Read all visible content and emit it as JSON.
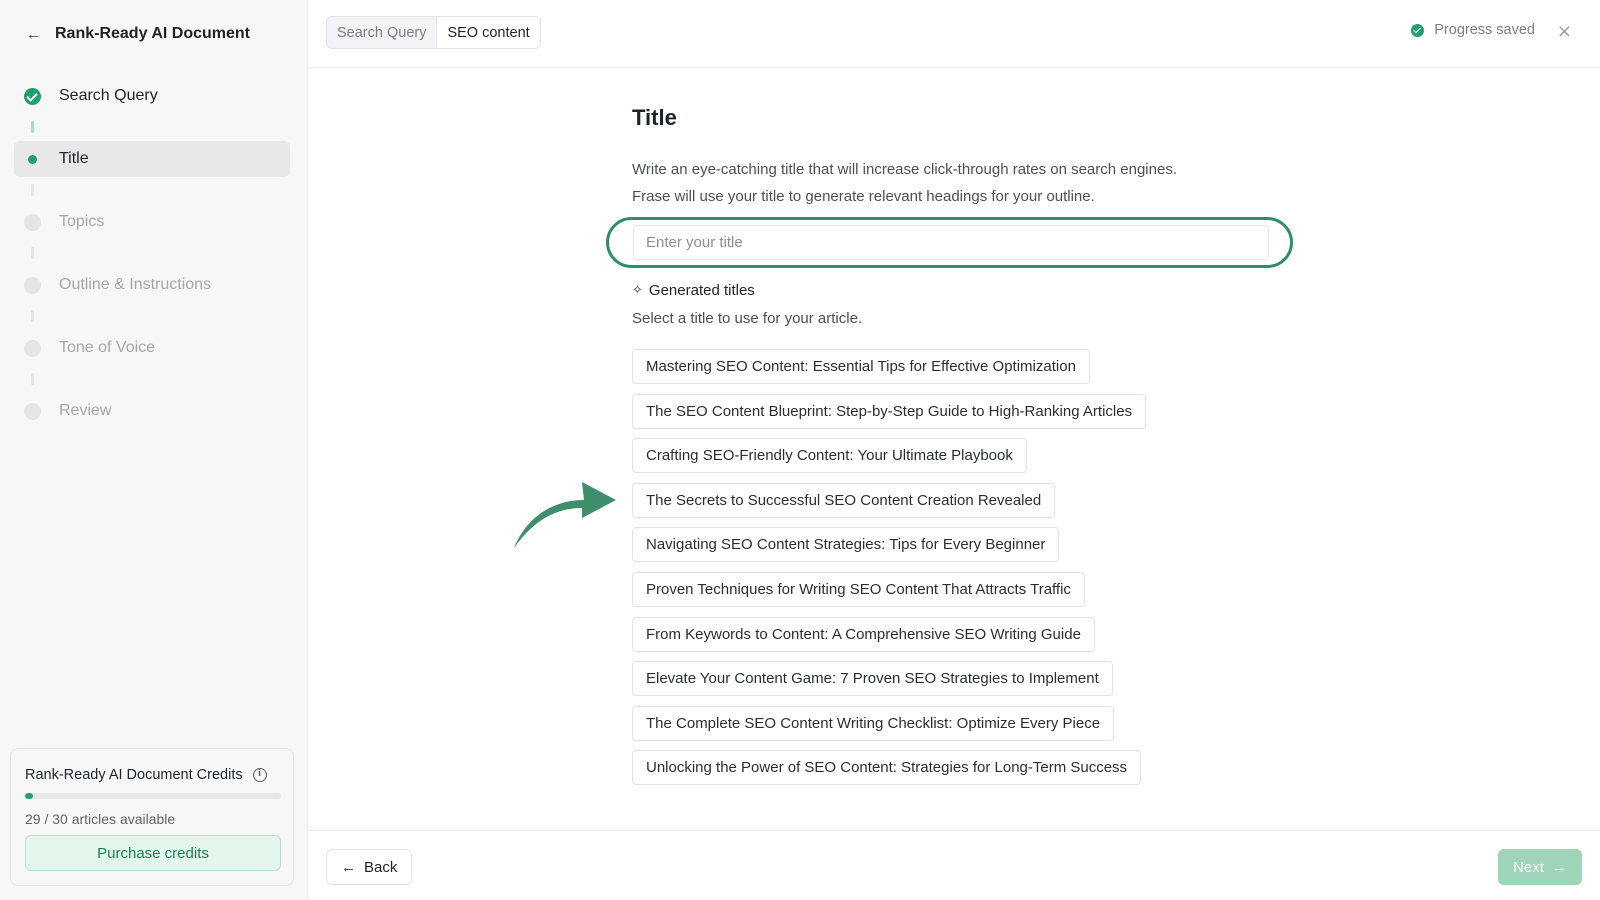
{
  "sidebar": {
    "header_title": "Rank-Ready AI Document",
    "steps": [
      {
        "label": "Search Query",
        "state": "done"
      },
      {
        "label": "Title",
        "state": "active"
      },
      {
        "label": "Topics",
        "state": "pending"
      },
      {
        "label": "Outline & Instructions",
        "state": "pending"
      },
      {
        "label": "Tone of Voice",
        "state": "pending"
      },
      {
        "label": "Review",
        "state": "pending"
      }
    ],
    "credits": {
      "title": "Rank-Ready AI Document Credits",
      "count_text": "29 / 30 articles available",
      "used_fraction": 0.033,
      "purchase_label": "Purchase credits"
    }
  },
  "topbar": {
    "tabs": [
      "Search Query",
      "SEO content"
    ],
    "progress_text": "Progress saved",
    "close_icon": "×"
  },
  "main": {
    "title": "Title",
    "description_line1": "Write an eye-catching title that will increase click-through rates on search engines.",
    "description_line2": "Frase will use your title to generate relevant headings for your outline.",
    "input_placeholder": "Enter your title",
    "generated_header": "Generated titles",
    "generated_subtext": "Select a title to use for your article.",
    "generated_titles": [
      "Mastering SEO Content: Essential Tips for Effective Optimization",
      "The SEO Content Blueprint: Step-by-Step Guide to High-Ranking Articles",
      "Crafting SEO-Friendly Content: Your Ultimate Playbook",
      "The Secrets to Successful SEO Content Creation Revealed",
      "Navigating SEO Content Strategies: Tips for Every Beginner",
      "Proven Techniques for Writing SEO Content That Attracts Traffic",
      "From Keywords to Content: A Comprehensive SEO Writing Guide",
      "Elevate Your Content Game: 7 Proven SEO Strategies to Implement",
      "The Complete SEO Content Writing Checklist: Optimize Every Piece",
      "Unlocking the Power of SEO Content: Strategies for Long-Term Success"
    ]
  },
  "footer": {
    "back_label": "Back",
    "next_label": "Next"
  },
  "colors": {
    "accent": "#22a06b",
    "input_highlight": "#2f8f63",
    "arrow": "#3f8f6a",
    "next_disabled": "#9ed4b8"
  },
  "icons": {
    "back_arrow": "←",
    "next_arrow": "→",
    "sparkle": "sparkle-icon"
  }
}
